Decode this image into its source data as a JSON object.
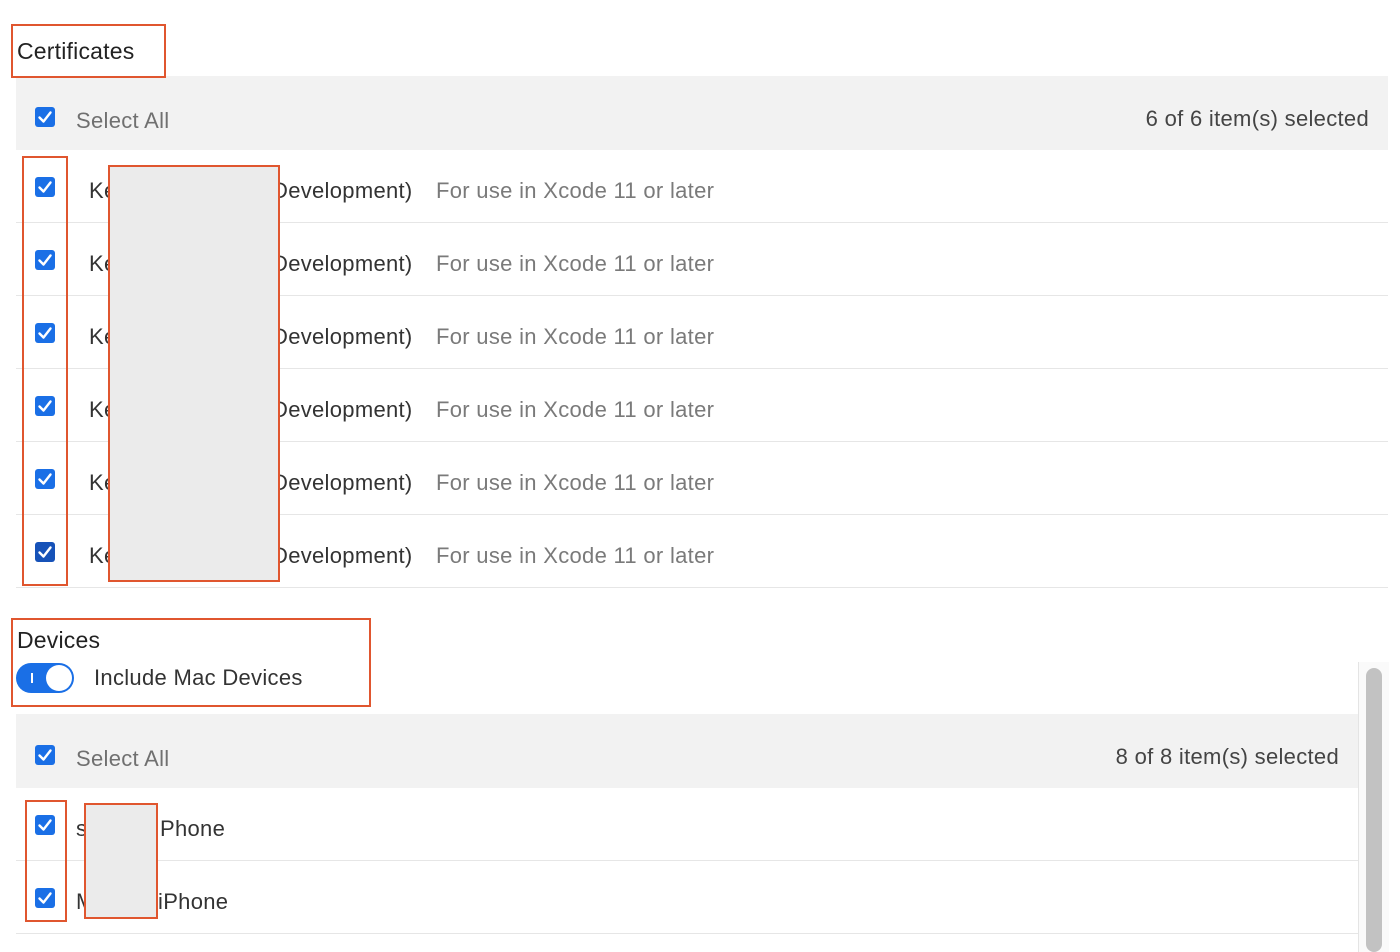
{
  "certificates": {
    "title": "Certificates",
    "select_all_label": "Select All",
    "count_label": "6 of 6 item(s) selected",
    "items": [
      {
        "name_start": "Ke",
        "name_end": "Development)",
        "note": "For use in Xcode 11 or later"
      },
      {
        "name_start": "Ke",
        "name_end": "Development)",
        "note": "For use in Xcode 11 or later"
      },
      {
        "name_start": "Ke",
        "name_end": "Development)",
        "note": "For use in Xcode 11 or later"
      },
      {
        "name_start": "Ke",
        "name_end": "Development)",
        "note": "For use in Xcode 11 or later"
      },
      {
        "name_start": "Ke",
        "name_end": "Development)",
        "note": "For use in Xcode 11 or later"
      },
      {
        "name_start": "Ke",
        "name_end": "Development)",
        "note": "For use in Xcode 11 or later"
      }
    ]
  },
  "devices": {
    "title": "Devices",
    "toggle_label": "Include Mac Devices",
    "toggle_on": true,
    "select_all_label": "Select All",
    "count_label": "8 of 8 item(s) selected",
    "items": [
      {
        "name_start": "s",
        "name_end": "Phone"
      },
      {
        "name_start": "M",
        "name_end": "iPhone"
      }
    ]
  },
  "colors": {
    "accent": "#1a6fe6",
    "annotation": "#e0562f",
    "redaction": "#ebebeb"
  },
  "icons": {
    "checkbox": "checkmark-icon",
    "toggle": "toggle-switch"
  }
}
